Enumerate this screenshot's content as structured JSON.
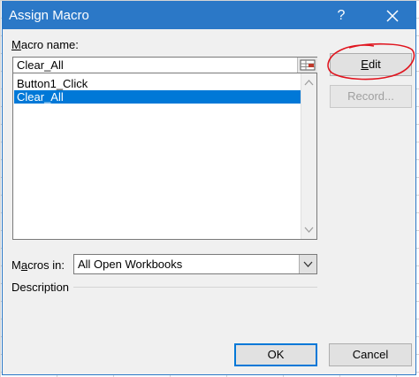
{
  "dialog": {
    "title": "Assign Macro",
    "help_label": "?",
    "macro_name_label": "Macro name:",
    "macro_name_value": "Clear_All",
    "macros": [
      {
        "name": "Button1_Click",
        "selected": false
      },
      {
        "name": "Clear_All",
        "selected": true
      }
    ],
    "buttons": {
      "edit": "Edit",
      "record": "Record...",
      "ok": "OK",
      "cancel": "Cancel"
    },
    "macros_in_label": "Macros in:",
    "macros_in_value": "All Open Workbooks",
    "description_label": "Description"
  },
  "colors": {
    "title_bar": "#2b78c7",
    "selection": "#0078d7",
    "annotation": "#e0141e"
  },
  "icons": [
    "close-icon",
    "range-picker-icon",
    "chevron-down-icon",
    "scroll-up-arrow-icon",
    "scroll-down-arrow-icon"
  ]
}
